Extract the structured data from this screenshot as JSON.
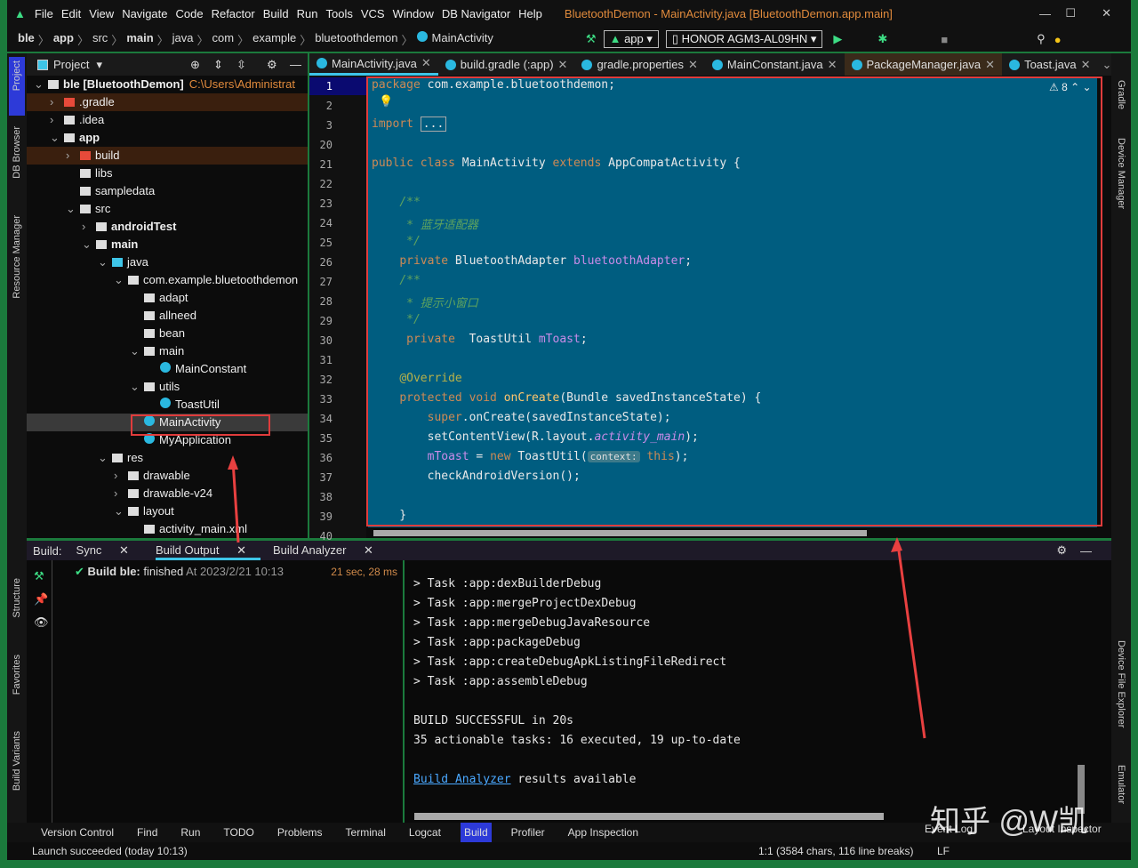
{
  "window": {
    "title": "BluetoothDemon - MainActivity.java [BluetoothDemon.app.main]",
    "menu": [
      "File",
      "Edit",
      "View",
      "Navigate",
      "Code",
      "Refactor",
      "Build",
      "Run",
      "Tools",
      "VCS",
      "Window",
      "DB Navigator",
      "Help"
    ]
  },
  "breadcrumb": [
    "ble",
    "app",
    "src",
    "main",
    "java",
    "com",
    "example",
    "bluetoothdemon",
    "MainActivity"
  ],
  "toolbar": {
    "config": "app",
    "device": "HONOR AGM3-AL09HN"
  },
  "left_strip": [
    "Project",
    "DB Browser",
    "Resource Manager",
    "Structure",
    "Favorites",
    "Build Variants"
  ],
  "right_strip": [
    "Gradle",
    "Device Manager",
    "Device File Explorer",
    "Emulator"
  ],
  "project": {
    "title": "Project",
    "tree": [
      {
        "label": "ble [BluetoothDemon]",
        "extra": "C:\\Users\\Administrat",
        "depth": 0,
        "type": "module",
        "bold": true
      },
      {
        "label": ".gradle",
        "depth": 1,
        "type": "folder-red",
        "style": "orange"
      },
      {
        "label": ".idea",
        "depth": 1,
        "type": "folder"
      },
      {
        "label": "app",
        "depth": 1,
        "type": "module",
        "bold": true
      },
      {
        "label": "build",
        "depth": 2,
        "type": "folder-red",
        "style": "orange"
      },
      {
        "label": "libs",
        "depth": 2,
        "type": "folder"
      },
      {
        "label": "sampledata",
        "depth": 2,
        "type": "folder"
      },
      {
        "label": "src",
        "depth": 2,
        "type": "folder"
      },
      {
        "label": "androidTest",
        "depth": 3,
        "type": "folder",
        "bold": true
      },
      {
        "label": "main",
        "depth": 3,
        "type": "folder",
        "bold": true
      },
      {
        "label": "java",
        "depth": 4,
        "type": "folder-blue"
      },
      {
        "label": "com.example.bluetoothdemon",
        "depth": 5,
        "type": "package"
      },
      {
        "label": "adapt",
        "depth": 6,
        "type": "package"
      },
      {
        "label": "allneed",
        "depth": 6,
        "type": "package"
      },
      {
        "label": "bean",
        "depth": 6,
        "type": "package"
      },
      {
        "label": "main",
        "depth": 6,
        "type": "package"
      },
      {
        "label": "MainConstant",
        "depth": 7,
        "type": "class"
      },
      {
        "label": "utils",
        "depth": 6,
        "type": "package"
      },
      {
        "label": "ToastUtil",
        "depth": 7,
        "type": "class"
      },
      {
        "label": "MainActivity",
        "depth": 6,
        "type": "class",
        "style": "sel"
      },
      {
        "label": "MyApplication",
        "depth": 6,
        "type": "class"
      },
      {
        "label": "res",
        "depth": 4,
        "type": "folder"
      },
      {
        "label": "drawable",
        "depth": 5,
        "type": "folder"
      },
      {
        "label": "drawable-v24",
        "depth": 5,
        "type": "folder"
      },
      {
        "label": "layout",
        "depth": 5,
        "type": "folder"
      },
      {
        "label": "activity_main.xml",
        "depth": 6,
        "type": "file"
      }
    ]
  },
  "tabs": [
    {
      "label": "MainActivity.java",
      "active": true
    },
    {
      "label": "build.gradle (:app)"
    },
    {
      "label": "gradle.properties"
    },
    {
      "label": "MainConstant.java"
    },
    {
      "label": "PackageManager.java",
      "hl": true
    },
    {
      "label": "Toast.java"
    }
  ],
  "editor": {
    "warnings": "8",
    "lines": [
      {
        "n": "1",
        "html": "<span class='kw'>package</span> com.example.bluetoothdemon;"
      },
      {
        "n": "2",
        "html": ""
      },
      {
        "n": "3",
        "html": "<span class='kw'>import</span> <span style='border:1px solid #aaa;padding:0 2px'>...</span>"
      },
      {
        "n": "20",
        "html": ""
      },
      {
        "n": "21",
        "html": "<span class='kw'>public class</span> MainActivity <span class='kw'>extends</span> AppCompatActivity {"
      },
      {
        "n": "22",
        "html": ""
      },
      {
        "n": "23",
        "html": "    <span class='cm'>/**</span>"
      },
      {
        "n": "24",
        "html": "<span class='cm'>     * 蓝牙适配器</span>"
      },
      {
        "n": "25",
        "html": "<span class='cm'>     */</span>"
      },
      {
        "n": "26",
        "html": "    <span class='kw'>private</span> BluetoothAdapter <span class='fld'>bluetoothAdapter</span>;"
      },
      {
        "n": "27",
        "html": "    <span class='cm'>/**</span>"
      },
      {
        "n": "28",
        "html": "<span class='cm'>     * 提示小窗口</span>"
      },
      {
        "n": "29",
        "html": "<span class='cm'>     */</span>"
      },
      {
        "n": "30",
        "html": "     <span class='kw'>private</span>  ToastUtil <span class='fld'>mToast</span>;"
      },
      {
        "n": "31",
        "html": ""
      },
      {
        "n": "32",
        "html": "    <span class='an'>@Override</span>"
      },
      {
        "n": "33",
        "html": "    <span class='kw'>protected void</span> <span class='fn'>onCreate</span>(Bundle savedInstanceState) {"
      },
      {
        "n": "34",
        "html": "        <span class='kw'>super</span>.onCreate(savedInstanceState);"
      },
      {
        "n": "35",
        "html": "        setContentView(R.layout.<span class='fld' style='font-style:italic'>activity_main</span>);"
      },
      {
        "n": "36",
        "html": "        <span class='fld'>mToast</span> = <span class='kw'>new</span> ToastUtil(<span class='hint'>context:</span> <span class='kw'>this</span>);"
      },
      {
        "n": "37",
        "html": "        checkAndroidVersion();"
      },
      {
        "n": "38",
        "html": ""
      },
      {
        "n": "39",
        "html": "    }"
      },
      {
        "n": "40",
        "html": ""
      }
    ]
  },
  "build": {
    "label": "Build:",
    "tabs": [
      "Sync",
      "Build Output",
      "Build Analyzer"
    ],
    "active_tab": "Build Output",
    "status_bold": "Build ble:",
    "status": "finished",
    "time": "At 2023/2/21 10:13",
    "duration": "21 sec, 28 ms",
    "console": [
      "> Task :app:dexBuilderDebug",
      "> Task :app:mergeProjectDexDebug",
      "> Task :app:mergeDebugJavaResource",
      "> Task :app:packageDebug",
      "> Task :app:createDebugApkListingFileRedirect",
      "> Task :app:assembleDebug",
      "",
      "BUILD SUCCESSFUL in 20s",
      "35 actionable tasks: 16 executed, 19 up-to-date",
      ""
    ],
    "link": "Build Analyzer",
    "link_rest": " results available"
  },
  "bottom_tools": [
    "Version Control",
    "Find",
    "Run",
    "TODO",
    "Problems",
    "Terminal",
    "Logcat",
    "Build",
    "Profiler",
    "App Inspection"
  ],
  "bottom_right": [
    "Event Log",
    "Layout Inspector"
  ],
  "status": {
    "message": "Launch succeeded (today 10:13)",
    "position": "1:1 (3584 chars, 116 line breaks)",
    "eol": "LF"
  },
  "watermark": "知乎 @W凯",
  "colors": {
    "editor_bg": "#005d80",
    "highlight_box": "#e03c3c",
    "window_border": "#1b7a3c"
  }
}
